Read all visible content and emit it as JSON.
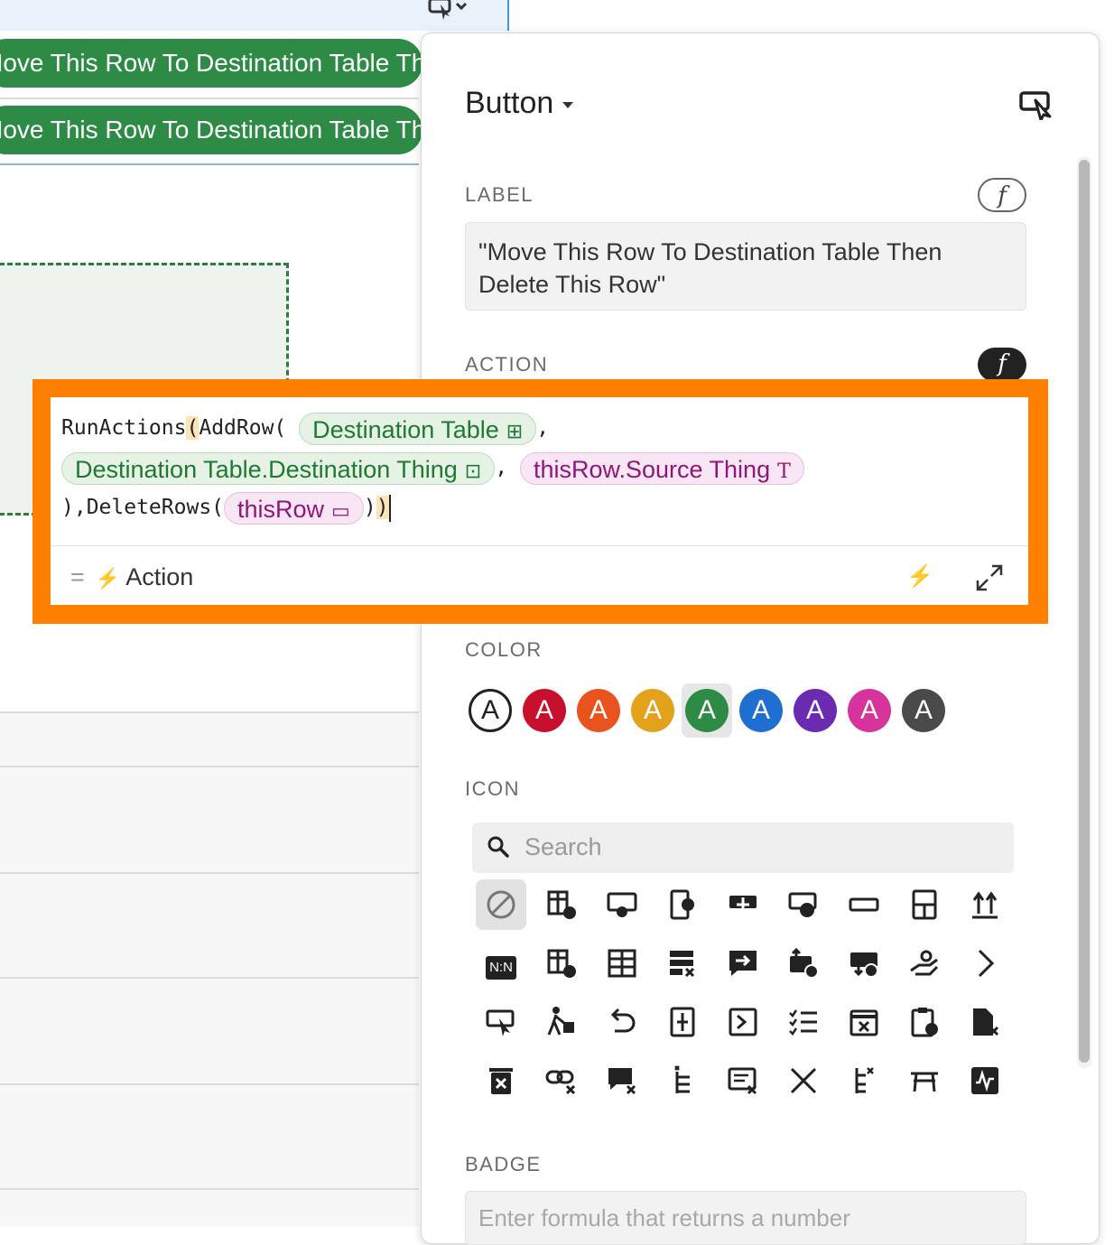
{
  "doc": {
    "button_label": "Move This Row To Destination Table Then Delete This Row"
  },
  "panel": {
    "title": "Button",
    "label_section": {
      "heading": "LABEL",
      "fx": "f",
      "value": "\"Move This Row To Destination Table Then Delete This Row\""
    },
    "action_section": {
      "heading": "ACTION",
      "fx": "f"
    },
    "color_section": {
      "heading": "COLOR",
      "swatch_letter": "A",
      "swatches": [
        {
          "name": "none",
          "color": "#ffffff"
        },
        {
          "name": "red",
          "color": "#c8102e"
        },
        {
          "name": "orange",
          "color": "#e8531e"
        },
        {
          "name": "yellow",
          "color": "#e2a21b"
        },
        {
          "name": "green",
          "color": "#2e8b45"
        },
        {
          "name": "blue",
          "color": "#1f6fd1"
        },
        {
          "name": "purple",
          "color": "#6a2bb0"
        },
        {
          "name": "pink",
          "color": "#d6339c"
        },
        {
          "name": "gray",
          "color": "#4a4a4a"
        }
      ],
      "selected": "green"
    },
    "icon_section": {
      "heading": "ICON",
      "search_placeholder": "Search",
      "nn_label": "N:N"
    },
    "badge_section": {
      "heading": "BADGE",
      "placeholder": "Enter formula that returns a number"
    }
  },
  "formula": {
    "fn_runactions": "RunActions",
    "open_paren": "(",
    "fn_addrow": "AddRow(",
    "chip_table": "Destination Table",
    "comma": ",",
    "chip_column": "Destination Table.Destination Thing",
    "chip_source": "thisRow.Source Thing",
    "source_type_glyph": "T",
    "fn_deleterows": "),DeleteRows(",
    "chip_thisrow": "thisRow",
    "close_inner": ")",
    "close_outer": ")",
    "result_type": "Action"
  }
}
